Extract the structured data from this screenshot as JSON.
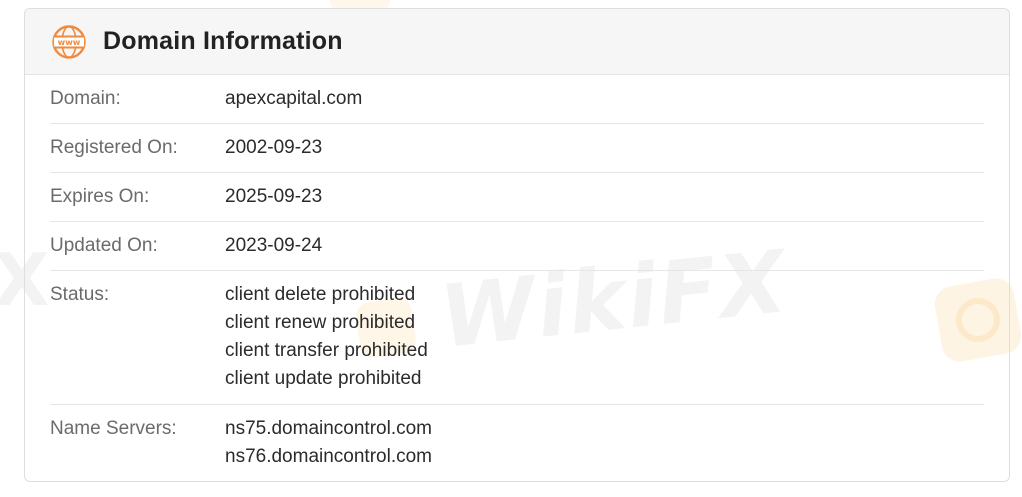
{
  "header": {
    "title": "Domain Information",
    "icon": "www-globe-icon",
    "icon_label": "www",
    "icon_color": "#f08a3c"
  },
  "rows": {
    "domain": {
      "label": "Domain:",
      "value": "apexcapital.com"
    },
    "registered": {
      "label": "Registered On:",
      "value": "2002-09-23"
    },
    "expires": {
      "label": "Expires On:",
      "value": "2025-09-23"
    },
    "updated": {
      "label": "Updated On:",
      "value": "2023-09-24"
    },
    "status": {
      "label": "Status:",
      "values": [
        "client delete prohibited",
        "client renew prohibited",
        "client transfer prohibited",
        "client update prohibited"
      ]
    },
    "name_servers": {
      "label": "Name Servers:",
      "values": [
        "ns75.domaincontrol.com",
        "ns76.domaincontrol.com"
      ]
    }
  },
  "watermark": {
    "text": "WikiFX",
    "left_fragment": "X"
  },
  "colors": {
    "label": "#6b6b6b",
    "value": "#2b2b2b",
    "title": "#222222",
    "accent": "#f08a3c"
  }
}
